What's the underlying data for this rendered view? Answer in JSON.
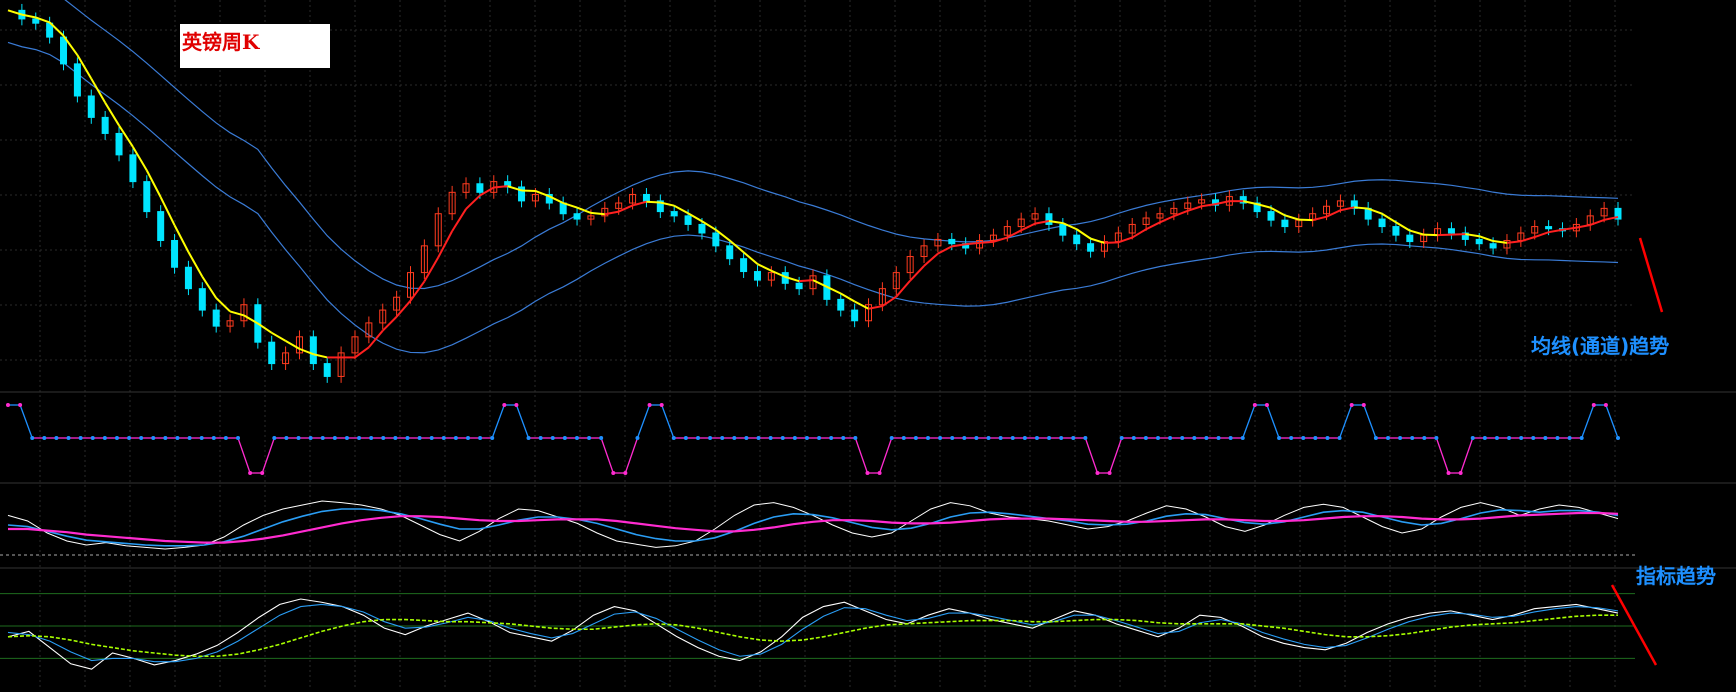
{
  "colors": {
    "background": "#000000",
    "grid": "#2a2a2a",
    "bull_candle": "#00e5ff",
    "bear_candle": "#ff3b1f",
    "ma_up": "#ff2020",
    "ma_down": "#ffff00",
    "channel": "#3a7bd5",
    "signal_high": "#ff2bd0",
    "signal_low": "#1e90ff",
    "annotation": "#1e90ff",
    "trend_line": "#ff0000",
    "stoch_white": "#ffffff",
    "stoch_blue": "#2a9df4",
    "stoch_magenta": "#ff2bd0",
    "rsi_green": "#a8ff00",
    "level_line": "#1e6b1e"
  },
  "labels": {
    "title": "英镑周K",
    "ma_annotation": "均线(通道)趋势",
    "indicator_annotation": "指标趋势"
  },
  "chart_data": [
    {
      "type": "candlestick",
      "title": "英镑周K",
      "series": [
        {
          "name": "",
          "values": [
            1.64,
            1.632,
            1.628,
            1.615,
            1.59,
            1.56,
            1.54,
            1.525,
            1.505,
            1.48,
            1.452,
            1.425,
            1.4,
            1.38,
            1.36,
            1.345,
            1.35,
            1.365,
            1.33,
            1.31,
            1.32,
            1.335,
            1.31,
            1.298,
            1.32,
            1.335,
            1.348,
            1.36,
            1.372,
            1.395,
            1.42,
            1.45,
            1.47,
            1.478,
            1.47,
            1.48,
            1.475,
            1.462,
            1.468,
            1.46,
            1.45,
            1.445,
            1.448,
            1.455,
            1.46,
            1.468,
            1.462,
            1.452,
            1.448,
            1.44,
            1.432,
            1.42,
            1.408,
            1.396,
            1.388,
            1.395,
            1.385,
            1.38,
            1.392,
            1.37,
            1.36,
            1.35,
            1.365,
            1.38,
            1.395,
            1.41,
            1.42,
            1.426,
            1.422,
            1.418,
            1.425,
            1.43,
            1.438,
            1.445,
            1.45,
            1.44,
            1.43,
            1.422,
            1.415,
            1.424,
            1.432,
            1.44,
            1.446,
            1.45,
            1.455,
            1.46,
            1.463,
            1.458,
            1.466,
            1.46,
            1.452,
            1.444,
            1.438,
            1.444,
            1.45,
            1.457,
            1.462,
            1.455,
            1.445,
            1.438,
            1.43,
            1.424,
            1.43,
            1.436,
            1.432,
            1.426,
            1.422,
            1.418,
            1.425,
            1.432,
            1.438,
            1.436,
            1.434,
            1.44,
            1.448,
            1.455,
            1.445
          ]
        }
      ]
    },
    {
      "type": "line",
      "series": [
        {
          "name": "",
          "values": [
            1,
            1,
            0,
            0,
            0,
            0,
            0,
            0,
            0,
            0,
            0,
            0,
            0,
            0,
            0,
            0,
            0,
            0,
            0,
            0,
            -1,
            -1,
            0,
            0,
            0,
            0,
            0,
            0,
            0,
            0,
            0,
            0,
            0,
            0,
            0,
            0,
            0,
            0,
            0,
            0,
            0,
            1,
            1,
            0,
            0,
            0,
            0,
            0,
            0,
            0,
            -1,
            -1,
            0,
            1,
            1,
            0,
            0,
            0,
            0,
            0,
            0,
            0,
            0,
            0,
            0,
            0,
            0,
            0,
            0,
            0,
            0,
            -1,
            -1,
            0,
            0,
            0,
            0,
            0,
            0,
            0,
            0,
            0,
            0,
            0,
            0,
            0,
            0,
            0,
            0,
            0,
            -1,
            -1,
            0,
            0,
            0,
            0,
            0,
            0,
            0,
            0,
            0,
            0,
            0,
            1,
            1,
            0,
            0,
            0,
            0,
            0,
            0,
            1,
            1,
            0,
            0,
            0,
            0,
            0,
            0,
            -1,
            -1,
            0,
            0,
            0,
            0,
            0,
            0,
            0,
            0,
            0,
            0,
            1,
            1,
            0
          ]
        }
      ]
    },
    {
      "type": "line",
      "series": [
        {
          "name": "",
          "values": [
            62,
            55,
            40,
            30,
            25,
            28,
            24,
            22,
            20,
            22,
            25,
            35,
            50,
            62,
            70,
            75,
            80,
            78,
            75,
            70,
            62,
            50,
            38,
            30,
            42,
            58,
            70,
            68,
            60,
            52,
            40,
            30,
            26,
            22,
            24,
            30,
            45,
            62,
            75,
            78,
            72,
            62,
            50,
            40,
            35,
            40,
            55,
            70,
            78,
            74,
            65,
            60,
            58,
            55,
            50,
            45,
            48,
            55,
            65,
            74,
            70,
            60,
            48,
            42,
            50,
            62,
            72,
            76,
            72,
            60,
            48,
            40,
            45,
            60,
            72,
            78,
            72,
            62,
            70,
            75,
            72,
            65,
            58
          ]
        },
        {
          "name": "",
          "values": [
            50,
            48,
            42,
            36,
            31,
            29,
            27,
            25,
            24,
            24,
            25,
            29,
            36,
            45,
            54,
            61,
            67,
            70,
            70,
            68,
            64,
            58,
            51,
            45,
            45,
            50,
            56,
            60,
            60,
            57,
            52,
            45,
            38,
            33,
            30,
            30,
            34,
            42,
            52,
            60,
            64,
            63,
            59,
            53,
            47,
            44,
            46,
            52,
            60,
            65,
            66,
            64,
            61,
            58,
            55,
            51,
            50,
            51,
            55,
            61,
            64,
            63,
            58,
            53,
            51,
            54,
            60,
            66,
            68,
            66,
            60,
            54,
            50,
            52,
            58,
            65,
            69,
            68,
            66,
            68,
            68,
            66,
            62
          ]
        },
        {
          "name": "",
          "values": [
            45,
            45,
            43,
            41,
            38,
            36,
            34,
            32,
            30,
            29,
            28,
            28,
            30,
            33,
            37,
            42,
            47,
            52,
            56,
            59,
            61,
            61,
            60,
            58,
            56,
            55,
            55,
            56,
            57,
            57,
            57,
            55,
            52,
            49,
            46,
            44,
            42,
            42,
            44,
            47,
            51,
            54,
            56,
            56,
            55,
            53,
            52,
            52,
            53,
            55,
            57,
            58,
            58,
            58,
            57,
            56,
            55,
            54,
            54,
            55,
            56,
            57,
            57,
            56,
            55,
            55,
            56,
            58,
            60,
            61,
            61,
            60,
            58,
            57,
            57,
            58,
            60,
            62,
            63,
            64,
            65,
            65,
            64
          ]
        }
      ]
    },
    {
      "type": "line",
      "series": [
        {
          "name": "",
          "values": [
            40,
            45,
            30,
            15,
            10,
            25,
            20,
            14,
            18,
            24,
            32,
            44,
            58,
            70,
            75,
            72,
            68,
            60,
            48,
            42,
            50,
            56,
            62,
            54,
            44,
            40,
            36,
            46,
            60,
            68,
            64,
            52,
            40,
            30,
            22,
            18,
            26,
            40,
            58,
            68,
            72,
            64,
            56,
            52,
            60,
            66,
            62,
            56,
            52,
            48,
            56,
            64,
            60,
            52,
            46,
            40,
            48,
            60,
            58,
            50,
            40,
            34,
            30,
            28,
            34,
            44,
            52,
            58,
            62,
            64,
            60,
            56,
            60,
            66,
            68,
            70,
            66,
            62
          ]
        },
        {
          "name": "",
          "values": [
            44,
            42,
            36,
            26,
            18,
            20,
            20,
            17,
            17,
            20,
            26,
            36,
            48,
            60,
            68,
            70,
            68,
            63,
            54,
            48,
            49,
            53,
            58,
            55,
            48,
            43,
            39,
            43,
            52,
            61,
            63,
            57,
            47,
            37,
            28,
            22,
            24,
            33,
            47,
            59,
            67,
            66,
            60,
            55,
            57,
            62,
            62,
            59,
            55,
            51,
            54,
            60,
            60,
            55,
            49,
            43,
            45,
            53,
            56,
            52,
            44,
            38,
            33,
            30,
            32,
            39,
            47,
            54,
            59,
            62,
            61,
            58,
            59,
            63,
            66,
            68,
            67,
            64
          ]
        },
        {
          "name": "",
          "values": [
            40,
            41,
            40,
            37,
            33,
            30,
            27,
            25,
            23,
            22,
            22,
            24,
            28,
            33,
            39,
            45,
            50,
            54,
            56,
            56,
            55,
            54,
            54,
            53,
            52,
            50,
            48,
            47,
            47,
            49,
            51,
            52,
            51,
            48,
            44,
            40,
            37,
            36,
            37,
            40,
            44,
            48,
            51,
            52,
            53,
            54,
            55,
            55,
            55,
            54,
            54,
            55,
            56,
            56,
            55,
            53,
            52,
            52,
            52,
            52,
            50,
            48,
            45,
            42,
            40,
            40,
            41,
            43,
            46,
            49,
            51,
            52,
            53,
            55,
            57,
            59,
            60,
            60
          ]
        }
      ],
      "levels": [
        80,
        50,
        20
      ]
    }
  ]
}
